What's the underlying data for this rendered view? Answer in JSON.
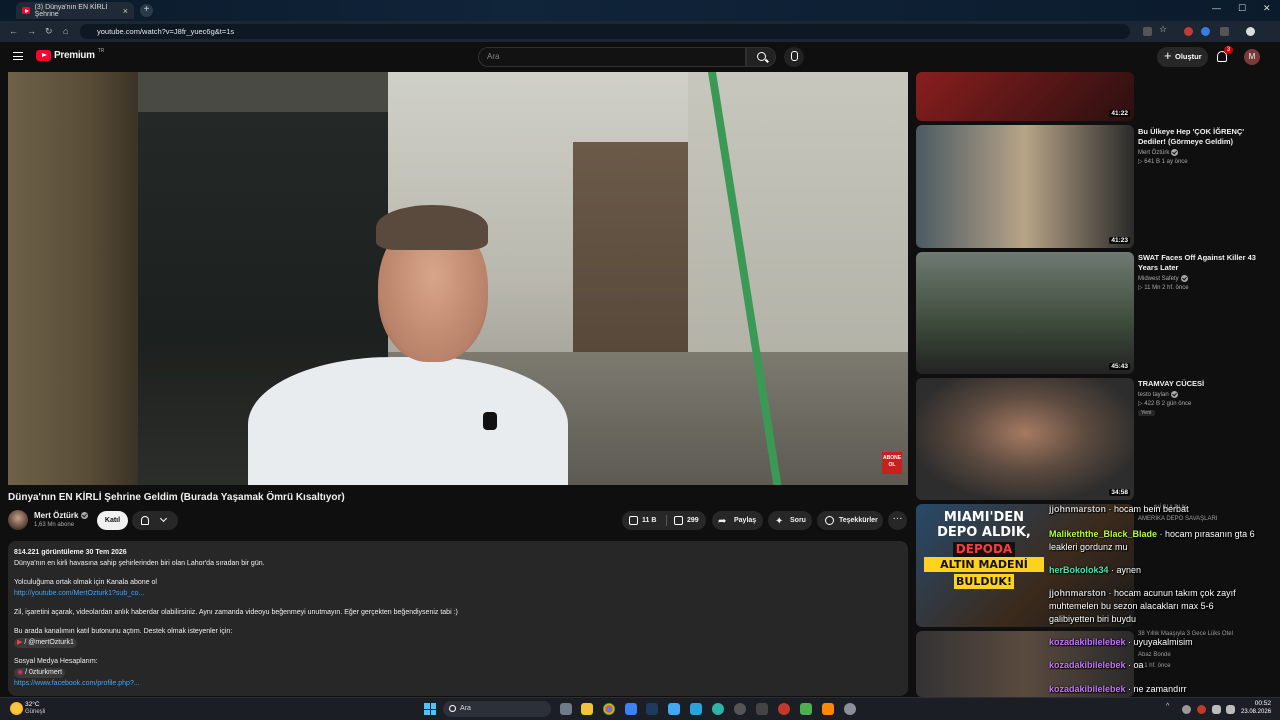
{
  "browser": {
    "tab_title": "(3) Dünya'nın EN KİRLİ Şehrine",
    "tab_close": "×",
    "new_tab": "+",
    "url": "youtube.com/watch?v=J8fr_yuec6g&t=1s",
    "window_minimize": "—",
    "window_maximize": "☐",
    "window_close": "✕"
  },
  "header": {
    "logo_text": "Premium",
    "logo_country": "TR",
    "search_placeholder": "Ara",
    "create_label": "Oluştur",
    "notifications_count": "3",
    "avatar_letter": "M"
  },
  "player": {
    "watermark": "ABONE OL"
  },
  "video": {
    "title": "Dünya'nın EN KİRLİ Şehrine Geldim (Burada Yaşamak Ömrü Kısaltıyor)",
    "channel_name": "Mert Öztürk",
    "subscribers": "1,63 Mn abone",
    "join_label": "Katıl",
    "like_count": "11 B",
    "dislike_count": "299",
    "share_label": "Paylaş",
    "clip_label": "Soru",
    "thanks_label": "Teşekkürler",
    "more_label": "···"
  },
  "description": {
    "meta": "814.221 görüntüleme  30 Tem 2026",
    "lines": [
      "Dünya'nın en kirli havasına sahip şehirlerinden biri olan Lahor'da sıradan bir gün.",
      "Yolculuğuma ortak olmak için Kanala abone ol",
      "http://youtube.com/MertOzturk1?sub_co...",
      "Zil, işaretini açarak, videolardan anlık haberdar olabilirsiniz. Aynı zamanda videoyu beğenmeyi unutmayın. Eğer gerçekten beğendiyseniz tabi :)",
      "Bu arada kanalımın katıl butonunu açtım. Destek olmak isteyenler için:",
      "/ @mertOzturk1",
      "Sosyal Medya Hesaplarım:",
      "/ 0zturkmert",
      "https://www.facebook.com/profile.php?..."
    ]
  },
  "recommendations": [
    {
      "duration": "41:22",
      "colors": [
        "#7a1b1b",
        "#2a1010"
      ]
    },
    {
      "title": "Bu Ülkeye Hep 'ÇOK İĞRENÇ' Dediler! (Görmeye Geldim)",
      "channel": "Mert Öztürk",
      "meta": "▷ 641 B   1 ay önce",
      "duration": "41:23",
      "colors": [
        "#4a5a63",
        "#b8a488"
      ]
    },
    {
      "title": "SWAT Faces Off Against Killer 43 Years Later",
      "channel": "Midwest Safety",
      "meta": "▷ 11 Mn   2 hf. önce",
      "duration": "45:43",
      "colors": [
        "#3c4a3a",
        "#8a968c"
      ]
    },
    {
      "title": "TRAMVAY CÜCESİ",
      "channel": "testo taylan",
      "meta": "▷ 422 B   2 gün önce",
      "badge": "Yeni",
      "duration": "34:58",
      "colors": [
        "#2f2f2f",
        "#8c6a58"
      ]
    }
  ],
  "promo_thumb": {
    "headline_1": "MIAMI'DEN",
    "headline_2": "DEPO ALDIK,",
    "headline_3": "DEPODA",
    "headline_4": "ALTIN MADENİ",
    "headline_5": "BULDUK!"
  },
  "chat": [
    {
      "user": "jjohnmarston",
      "text": "hocam bein berbat",
      "color": "#c9c9c9"
    },
    {
      "user": "Malikeththe_Black_Blade",
      "text": "hocam pırasanın gta 6 leakleri gordunz mu",
      "color": "#b6ff3c"
    },
    {
      "user": "herBokolok34",
      "text": "aynen",
      "color": "#46e6b0"
    },
    {
      "user": "jjohnmarston",
      "text": "hocam acunun takım çok zayıf muhtemelen bu sezon alacakları max 5-6 galibiyetten biri buydu",
      "color": "#c9c9c9"
    },
    {
      "user": "kozadakibilelebek",
      "text": "uyuyakalmisim",
      "color": "#c275ff"
    },
    {
      "user": "kozadakibilelebek",
      "text": "oa",
      "color": "#c275ff"
    },
    {
      "user": "kozadakibilelebek",
      "text": "ne zamandırr",
      "color": "#c275ff"
    }
  ],
  "chat_ghosts": {
    "g1": "...Nİ BULDUK",
    "g2": "AMERİKA DEPO SAVAŞLARI",
    "g3": "38 Yıllık Maaşıyla 3 Gece Lüks Otel",
    "g4": "Abaz Bonde",
    "g5": "▷ 1 hf. önce"
  },
  "taskbar": {
    "weather_temp": "32°C",
    "weather_desc": "Güneşli",
    "search_label": "Ara",
    "time": "00:52",
    "date": "23.08.2026",
    "tray_up": "^"
  }
}
